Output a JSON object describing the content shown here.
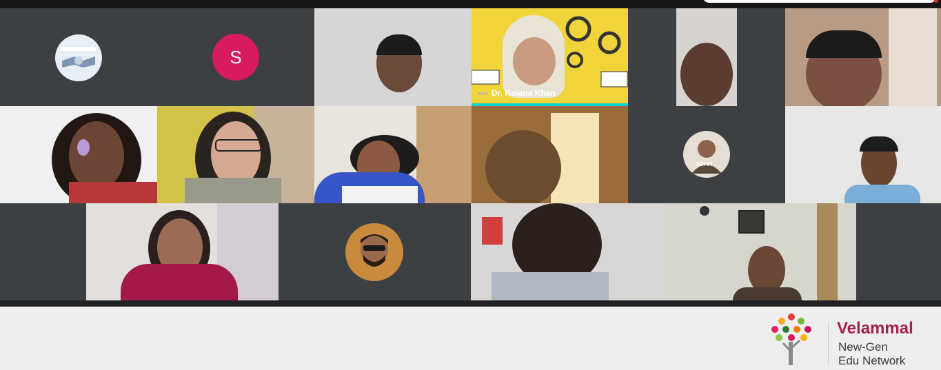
{
  "meeting": {
    "speaker_name": "Dr. Roiana Khan",
    "avatar_letter": "S",
    "avatar_color": "#d81b60",
    "speaking_color": "#00d1d1",
    "tile_background": "#3c4043",
    "badge_text": "ROHIT"
  },
  "branding": {
    "line1": "Velammal",
    "line2": "New-Gen",
    "line3": "Edu Network",
    "brand_color": "#a2214e"
  }
}
